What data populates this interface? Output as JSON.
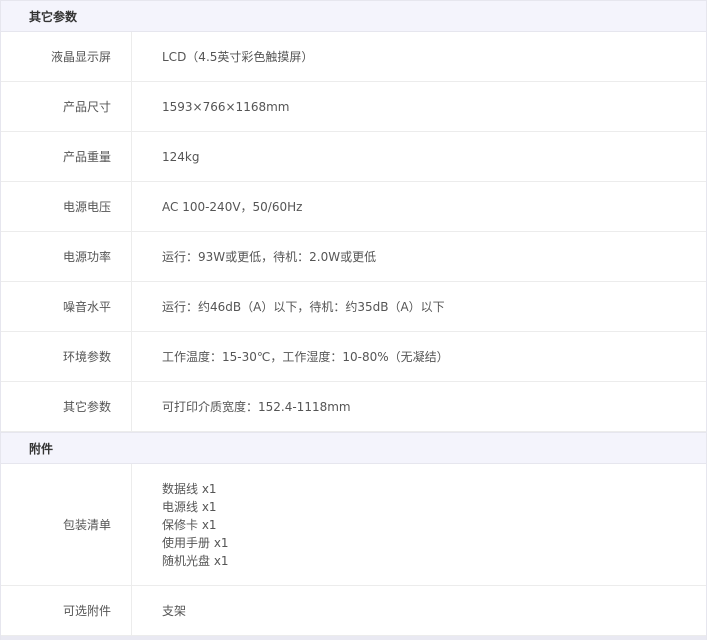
{
  "sections": [
    {
      "title": "其它参数",
      "rows": [
        {
          "label": "液晶显示屏",
          "value": "LCD（4.5英寸彩色触摸屏）"
        },
        {
          "label": "产品尺寸",
          "value": "1593×766×1168mm"
        },
        {
          "label": "产品重量",
          "value": "124kg"
        },
        {
          "label": "电源电压",
          "value": "AC 100-240V，50/60Hz"
        },
        {
          "label": "电源功率",
          "value": "运行：93W或更低，待机：2.0W或更低"
        },
        {
          "label": "噪音水平",
          "value": "运行：约46dB（A）以下，待机：约35dB（A）以下"
        },
        {
          "label": "环境参数",
          "value": "工作温度：15-30℃，工作湿度：10-80%（无凝结）"
        },
        {
          "label": "其它参数",
          "value": "可打印介质宽度：152.4-1118mm"
        }
      ]
    },
    {
      "title": "附件",
      "rows": [
        {
          "label": "包装清单",
          "lines": [
            "数据线 x1",
            "电源线 x1",
            "保修卡 x1",
            "使用手册 x1",
            "随机光盘 x1"
          ]
        },
        {
          "label": "可选附件",
          "value": "支架"
        }
      ]
    }
  ]
}
